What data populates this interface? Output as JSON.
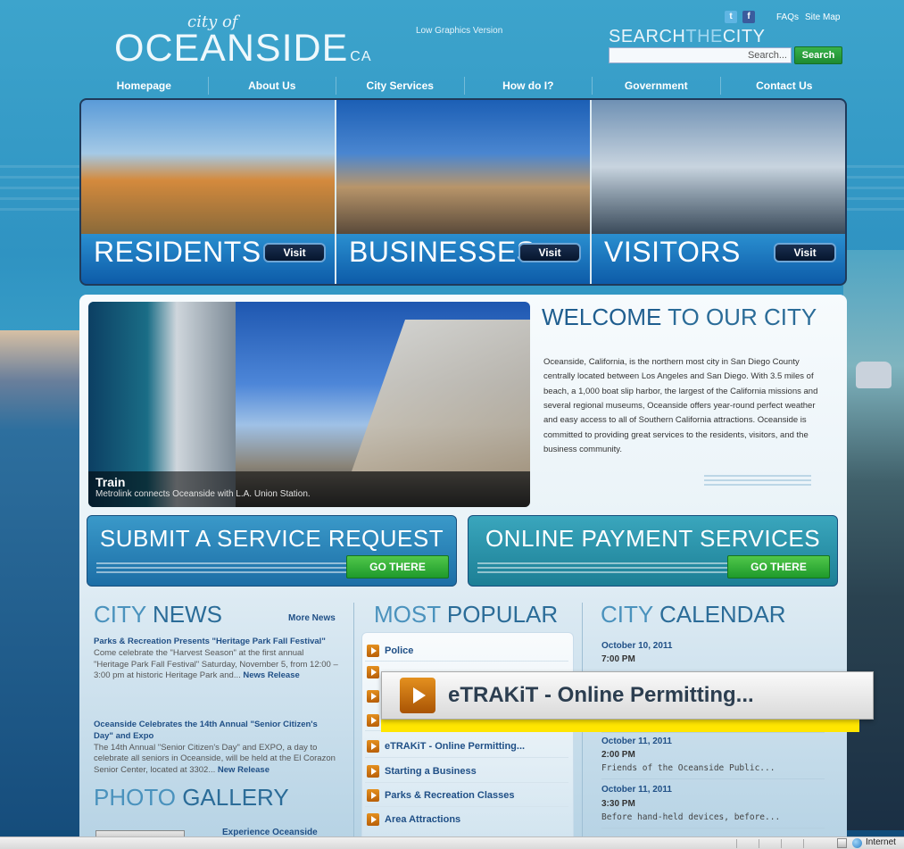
{
  "header": {
    "logo_script": "city of",
    "logo_main": "OCEANSIDE",
    "logo_suffix": "CA",
    "low_graphics": "Low Graphics Version",
    "faqs": "FAQs",
    "site_map": "Site Map",
    "search_label_a": "SEARCH",
    "search_label_b": "THE",
    "search_label_c": "CITY",
    "search_value": "Search...",
    "search_button": "Search"
  },
  "nav": [
    "Homepage",
    "About Us",
    "City Services",
    "How do I?",
    "Government",
    "Contact Us"
  ],
  "hero": [
    {
      "title": "RESIDENTS",
      "button": "Visit"
    },
    {
      "title": "BUSINESSES",
      "button": "Visit"
    },
    {
      "title": "VISITORS",
      "button": "Visit"
    }
  ],
  "feature": {
    "title": "Train",
    "subtitle": "Metrolink connects Oceanside with L.A. Union Station."
  },
  "welcome": {
    "title_a": "WELCOME",
    "title_b": " TO OUR CITY",
    "text": "Oceanside, California, is the northern most city in San Diego County centrally located between Los Angeles and San Diego.  With 3.5 miles of beach, a 1,000 boat slip harbor, the largest of the California missions and several regional museums, Oceanside offers year-round perfect weather and easy access to all of Southern California attractions. Oceanside is committed to providing great services to the residents, visitors, and the business community."
  },
  "cta": {
    "left_title": "SUBMIT A SERVICE REQUEST",
    "left_button": "GO THERE",
    "right_title": "ONLINE PAYMENT SERVICES",
    "right_button": "GO THERE"
  },
  "news": {
    "title_a": "CITY",
    "title_b": " NEWS",
    "more": "More News",
    "items": [
      {
        "headline": "Parks & Recreation Presents \"Heritage Park Fall Festival\"",
        "body": "Come celebrate the \"Harvest Season\" at the first annual \"Heritage Park Fall Festival\" Saturday, November 5, from 12:00 – 3:00 pm at historic Heritage Park and...",
        "tag": "News Release"
      },
      {
        "headline": "Oceanside Celebrates the 14th Annual \"Senior Citizen's Day\" and Expo",
        "body": "The 14th Annual \"Senior Citizen's Day\" and EXPO, a day to celebrate all seniors in Oceanside, will be held at the El Corazon Senior Center, located at 3302...",
        "tag": "New Release"
      }
    ]
  },
  "popular": {
    "title_a": "MOST",
    "title_b": " POPULAR",
    "items": [
      "Police",
      "eTRAKiT - Online Permitting...",
      "Starting a Business",
      "Parks & Recreation Classes",
      "Area Attractions"
    ]
  },
  "calendar": {
    "title_a": "CITY",
    "title_b": " CALENDAR",
    "events": [
      {
        "date": "October 10, 2011",
        "time": "7:00 PM",
        "desc": ""
      },
      {
        "date": "October 11, 2011",
        "time": "2:00 PM",
        "desc": "Friends of the Oceanside Public..."
      },
      {
        "date": "October 11, 2011",
        "time": "3:30 PM",
        "desc": "Before hand-held devices, before..."
      }
    ]
  },
  "gallery": {
    "title_a": "PHOTO",
    "title_b": " GALLERY",
    "caption": "Experience Oceanside"
  },
  "zoom": {
    "text": "eTRAKiT - Online Permitting..."
  },
  "status": {
    "zone": "Internet"
  },
  "colors": {
    "accent": "#2b6c98",
    "link": "#1f4f86",
    "go_green": "#1f9a2b",
    "highlight": "#ffe600"
  }
}
